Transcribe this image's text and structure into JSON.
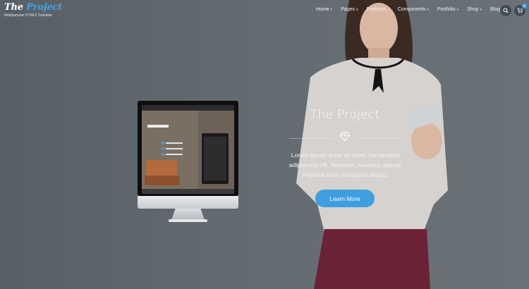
{
  "brand": {
    "title_part1": "The ",
    "title_part2": "Project",
    "subtitle": "Multipurpose HTML5 Template"
  },
  "nav": {
    "items": [
      {
        "label": "Home"
      },
      {
        "label": "Pages"
      },
      {
        "label": "Features"
      },
      {
        "label": "Components"
      },
      {
        "label": "Portfolio"
      },
      {
        "label": "Shop"
      },
      {
        "label": "Blog"
      }
    ],
    "cart_count": "0"
  },
  "hero": {
    "title": "The Project",
    "text": "Lorem ipsum dolor sit amet, consectetur adipisicing elit. Nesciunt, maiores, aliquid. Repellat eum numquam aliquid.",
    "button_label": "Learn More"
  },
  "colors": {
    "accent": "#3ea2e8",
    "button": "#3d9fe0",
    "background": "#5f676d"
  },
  "icons": [
    "search-icon",
    "cart-icon",
    "diamond-icon",
    "chevron-down-icon"
  ]
}
